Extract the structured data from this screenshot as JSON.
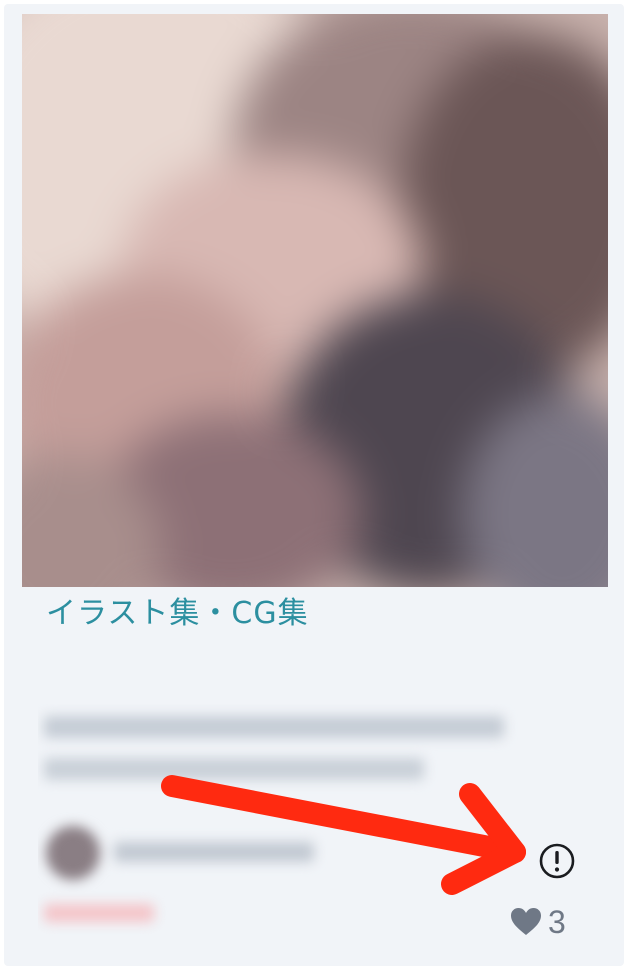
{
  "card": {
    "category_label": "イラスト集・CG集",
    "like_count": "3"
  },
  "icons": {
    "report": "report-exclamation-icon",
    "like": "heart-icon",
    "annotation": "red-arrow-annotation"
  },
  "colors": {
    "category_link": "#2c8fa0",
    "card_background": "#f1f4f8",
    "icon_gray": "#6f7886",
    "annotation_red": "#ff2a10"
  }
}
